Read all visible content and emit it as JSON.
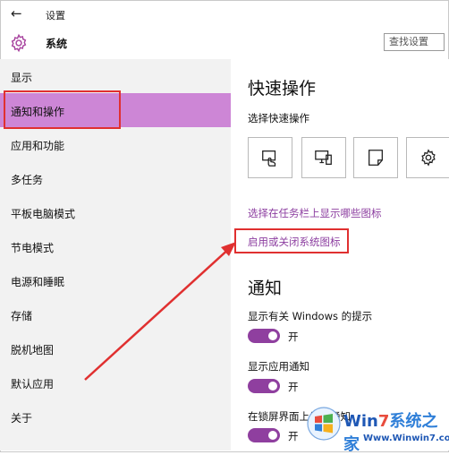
{
  "window": {
    "title": "设置",
    "back_icon": "back-arrow-icon"
  },
  "header": {
    "section": "系统",
    "search_placeholder": "查找设置"
  },
  "sidebar": {
    "items": [
      {
        "label": "显示",
        "selected": false
      },
      {
        "label": "通知和操作",
        "selected": true
      },
      {
        "label": "应用和功能",
        "selected": false
      },
      {
        "label": "多任务",
        "selected": false
      },
      {
        "label": "平板电脑模式",
        "selected": false
      },
      {
        "label": "节电模式",
        "selected": false
      },
      {
        "label": "电源和睡眠",
        "selected": false
      },
      {
        "label": "存储",
        "selected": false
      },
      {
        "label": "脱机地图",
        "selected": false
      },
      {
        "label": "默认应用",
        "selected": false
      },
      {
        "label": "关于",
        "selected": false
      }
    ]
  },
  "main": {
    "quick_actions_title": "快速操作",
    "quick_actions_subtitle": "选择快速操作",
    "tiles": [
      "tablet-mode-icon",
      "connect-icon",
      "note-icon",
      "settings-icon"
    ],
    "link_taskbar_icons": "选择在任务栏上显示哪些图标",
    "link_system_icons": "启用或关闭系统图标",
    "notifications_title": "通知",
    "options": [
      {
        "label": "显示有关 Windows 的提示",
        "toggle": "开",
        "on": true
      },
      {
        "label": "显示应用通知",
        "toggle": "开",
        "on": true
      },
      {
        "label": "在锁屏界面上显示通知",
        "toggle": "开",
        "on": true
      }
    ]
  },
  "watermark": {
    "brand_w": "Win",
    "brand_7": "7",
    "brand_zh": "系统之家",
    "url": "Www.Winwin7.com"
  },
  "colors": {
    "accent": "#8f3f9f",
    "selected_bg": "#cd86d6",
    "highlight": "#e03030",
    "link": "#8c3ea0"
  }
}
